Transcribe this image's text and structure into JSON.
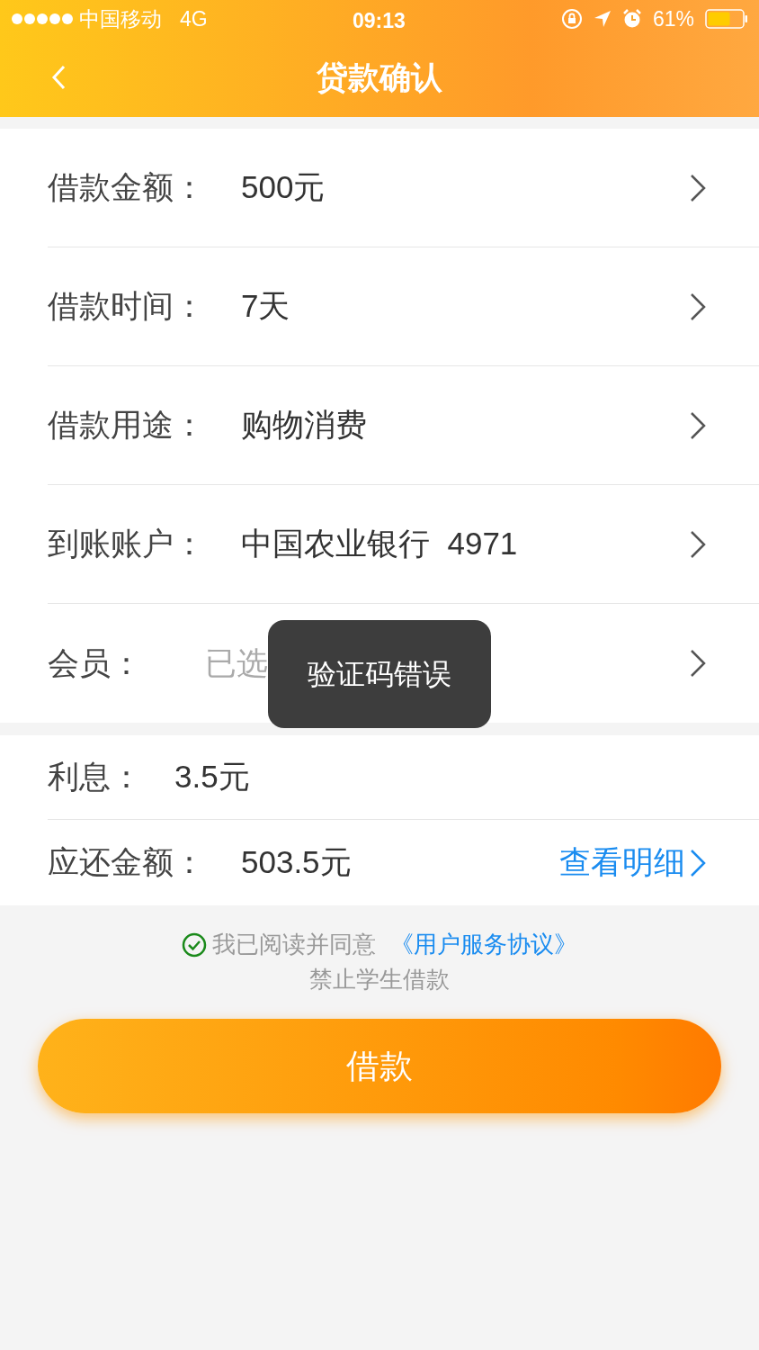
{
  "status_bar": {
    "carrier": "中国移动",
    "network": "4G",
    "time": "09:13",
    "battery": "61%"
  },
  "nav": {
    "title": "贷款确认"
  },
  "rows": [
    {
      "kind": "value",
      "label": "借款金额：",
      "value": "500元"
    },
    {
      "kind": "value",
      "label": "借款时间：",
      "value": "7天"
    },
    {
      "kind": "value",
      "label": "借款用途：",
      "value": "购物消费"
    },
    {
      "kind": "value",
      "label": "到账账户：",
      "value": "中国农业银行  4971"
    },
    {
      "kind": "hint",
      "label": "会员：",
      "value": "已选"
    }
  ],
  "interest": {
    "label": "利息：",
    "value": "3.5元"
  },
  "payable": {
    "label": "应还金额：",
    "value": "503.5元",
    "link": "查看明细"
  },
  "agreement": {
    "checked": true,
    "text": "我已阅读并同意",
    "link": "《用户服务协议》"
  },
  "notice": "禁止学生借款",
  "submit": "借款",
  "toast": "验证码错误"
}
